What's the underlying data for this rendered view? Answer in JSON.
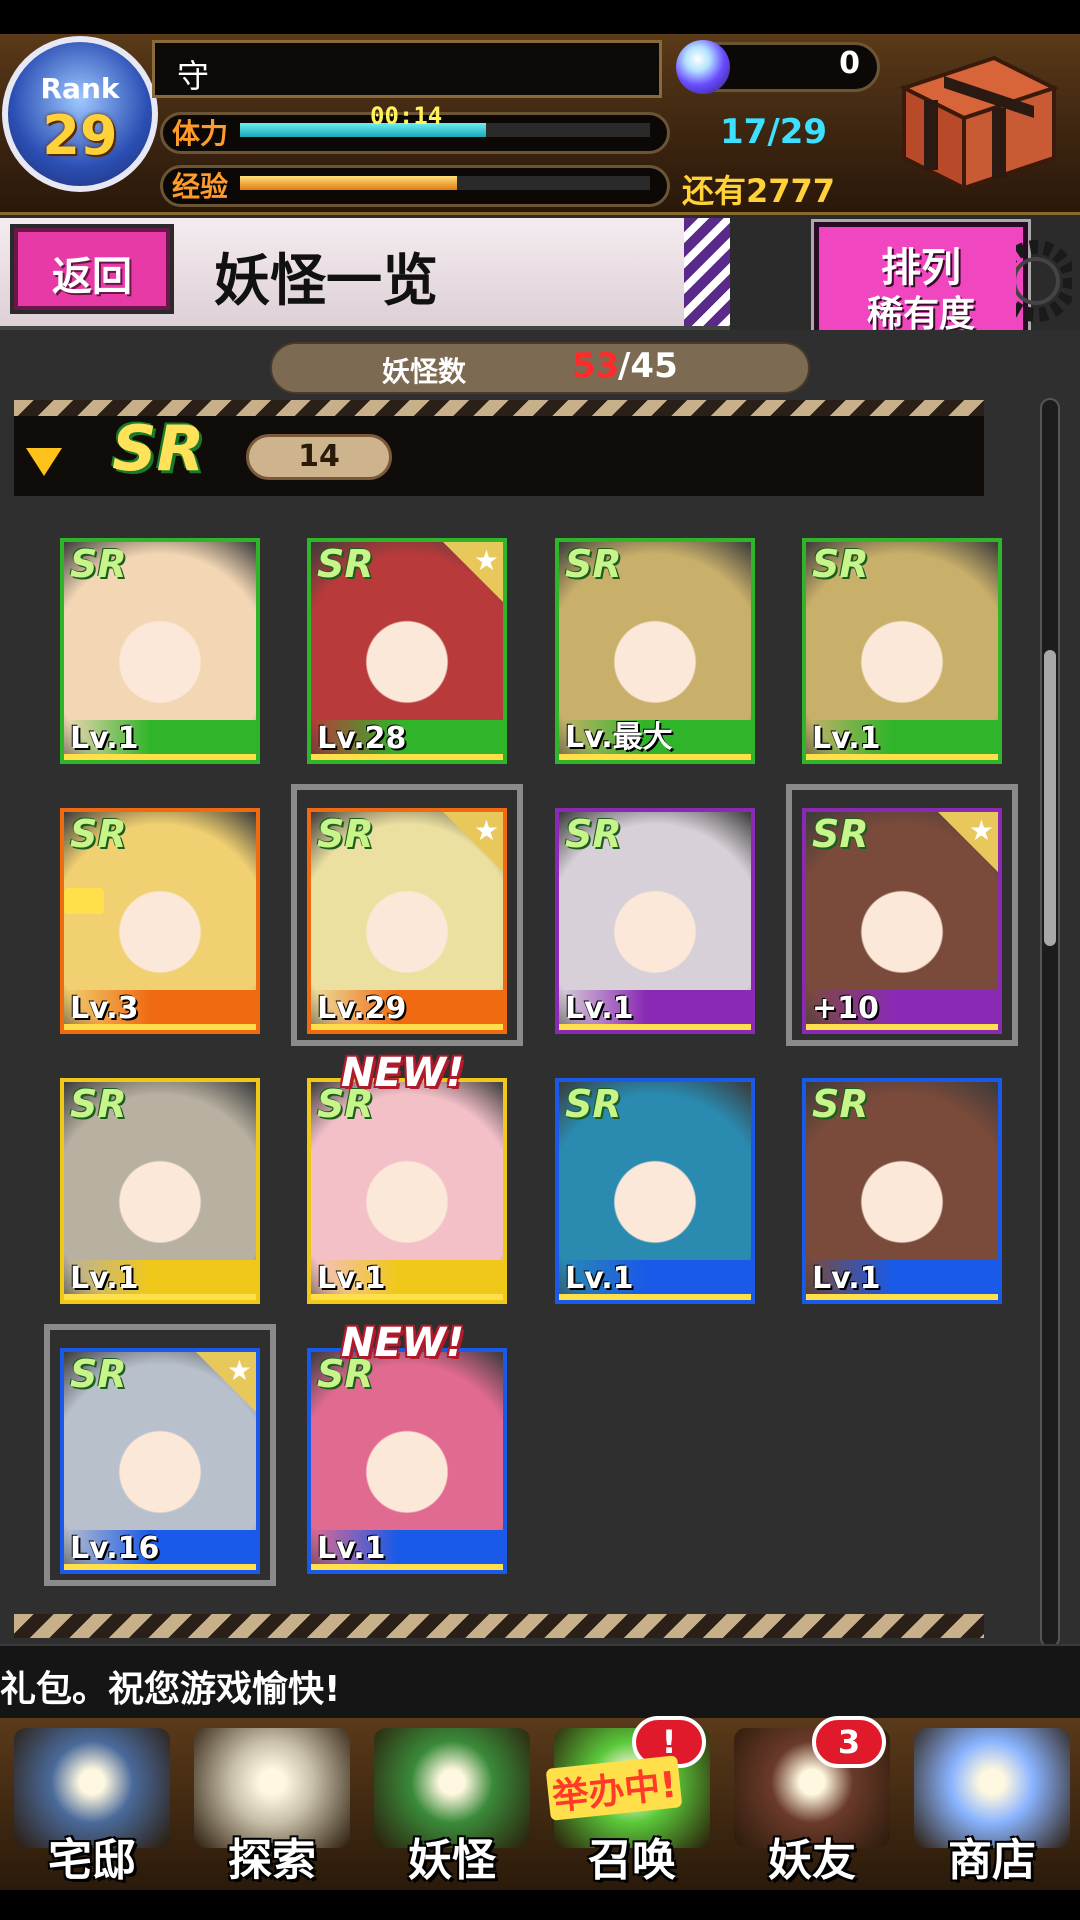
{
  "player": {
    "rank_label": "Rank",
    "rank": "29",
    "name": "守",
    "stamina_label": "体力",
    "stamina_timer": "00:14",
    "stamina_count": "17/29",
    "stamina_fraction": 0.6,
    "exp_label": "经验",
    "exp_remaining": "还有2777",
    "exp_fraction": 0.53,
    "orb_count": "0"
  },
  "titlebar": {
    "back_label": "返回",
    "title": "妖怪一览",
    "sort_line1": "排列",
    "sort_line2": "稀有度"
  },
  "count": {
    "label": "妖怪数",
    "owned": "53",
    "max": "/45"
  },
  "section": {
    "rarity": "SR",
    "count": "14"
  },
  "cards": [
    {
      "rarity": "SR",
      "level": "Lv.1",
      "frame": "#2fb42a",
      "band": "#2fb42a",
      "star": false,
      "selected": false,
      "new": false,
      "lock": false,
      "portrait": "#f3d7b4"
    },
    {
      "rarity": "SR",
      "level": "Lv.28",
      "frame": "#2fb42a",
      "band": "#2fb42a",
      "star": true,
      "selected": false,
      "new": false,
      "lock": false,
      "portrait": "#b83a3a"
    },
    {
      "rarity": "SR",
      "level": "Lv.最大",
      "frame": "#2fb42a",
      "band": "#2fb42a",
      "star": false,
      "selected": false,
      "new": false,
      "lock": false,
      "portrait": "#c9b06a"
    },
    {
      "rarity": "SR",
      "level": "Lv.1",
      "frame": "#2fb42a",
      "band": "#2fb42a",
      "star": false,
      "selected": false,
      "new": false,
      "lock": false,
      "portrait": "#c9b06a"
    },
    {
      "rarity": "SR",
      "level": "Lv.3",
      "frame": "#f06a12",
      "band": "#f06a12",
      "star": false,
      "selected": false,
      "new": false,
      "lock": true,
      "portrait": "#f0d070"
    },
    {
      "rarity": "SR",
      "level": "Lv.29",
      "frame": "#f06a12",
      "band": "#f06a12",
      "star": true,
      "selected": true,
      "new": false,
      "lock": false,
      "portrait": "#ece0a0"
    },
    {
      "rarity": "SR",
      "level": "Lv.1",
      "frame": "#8a2ab4",
      "band": "#8a2ab4",
      "star": false,
      "selected": false,
      "new": false,
      "lock": false,
      "portrait": "#d8d0d8"
    },
    {
      "rarity": "SR",
      "level": "+10",
      "frame": "#8a2ab4",
      "band": "#8a2ab4",
      "star": true,
      "selected": true,
      "new": false,
      "lock": false,
      "portrait": "#7a4a3a"
    },
    {
      "rarity": "SR",
      "level": "Lv.1",
      "frame": "#f0c81a",
      "band": "#f0c81a",
      "star": false,
      "selected": false,
      "new": false,
      "lock": false,
      "portrait": "#b8b0a0"
    },
    {
      "rarity": "SR",
      "level": "Lv.1",
      "frame": "#f0c81a",
      "band": "#f0c81a",
      "star": false,
      "selected": false,
      "new": true,
      "lock": false,
      "portrait": "#f4c0c8"
    },
    {
      "rarity": "SR",
      "level": "Lv.1",
      "frame": "#1a5ae8",
      "band": "#1a5ae8",
      "star": false,
      "selected": false,
      "new": false,
      "lock": false,
      "portrait": "#2a8ab0"
    },
    {
      "rarity": "SR",
      "level": "Lv.1",
      "frame": "#1a5ae8",
      "band": "#1a5ae8",
      "star": false,
      "selected": false,
      "new": false,
      "lock": false,
      "portrait": "#7a4a3a"
    },
    {
      "rarity": "SR",
      "level": "Lv.16",
      "frame": "#1a5ae8",
      "band": "#1a5ae8",
      "star": true,
      "selected": true,
      "new": false,
      "lock": false,
      "portrait": "#b8c0cc"
    },
    {
      "rarity": "SR",
      "level": "Lv.1",
      "frame": "#1a5ae8",
      "band": "#1a5ae8",
      "star": false,
      "selected": false,
      "new": true,
      "lock": false,
      "portrait": "#e06a90"
    }
  ],
  "new_label": "NEW!",
  "ticker": {
    "text": "礼包。祝您游戏愉快!"
  },
  "nav": [
    {
      "label": "宅邸",
      "icon": "mansion-icon",
      "badge": "",
      "art": "#4a6a9a"
    },
    {
      "label": "探索",
      "icon": "magnifier-map-icon",
      "badge": "",
      "art": "#c8c0a8"
    },
    {
      "label": "妖怪",
      "icon": "scroll-icon",
      "badge": "",
      "art": "#3a8a3a"
    },
    {
      "label": "召唤",
      "icon": "summon-star-icon",
      "badge": "!",
      "art": "#5ac83a"
    },
    {
      "label": "妖友",
      "icon": "friend-girl-icon",
      "badge": "3",
      "art": "#6a3a2a"
    },
    {
      "label": "商店",
      "icon": "crystal-orb-icon",
      "badge": "",
      "art": "#8ab4ff"
    }
  ],
  "event_tag": "举办中!"
}
